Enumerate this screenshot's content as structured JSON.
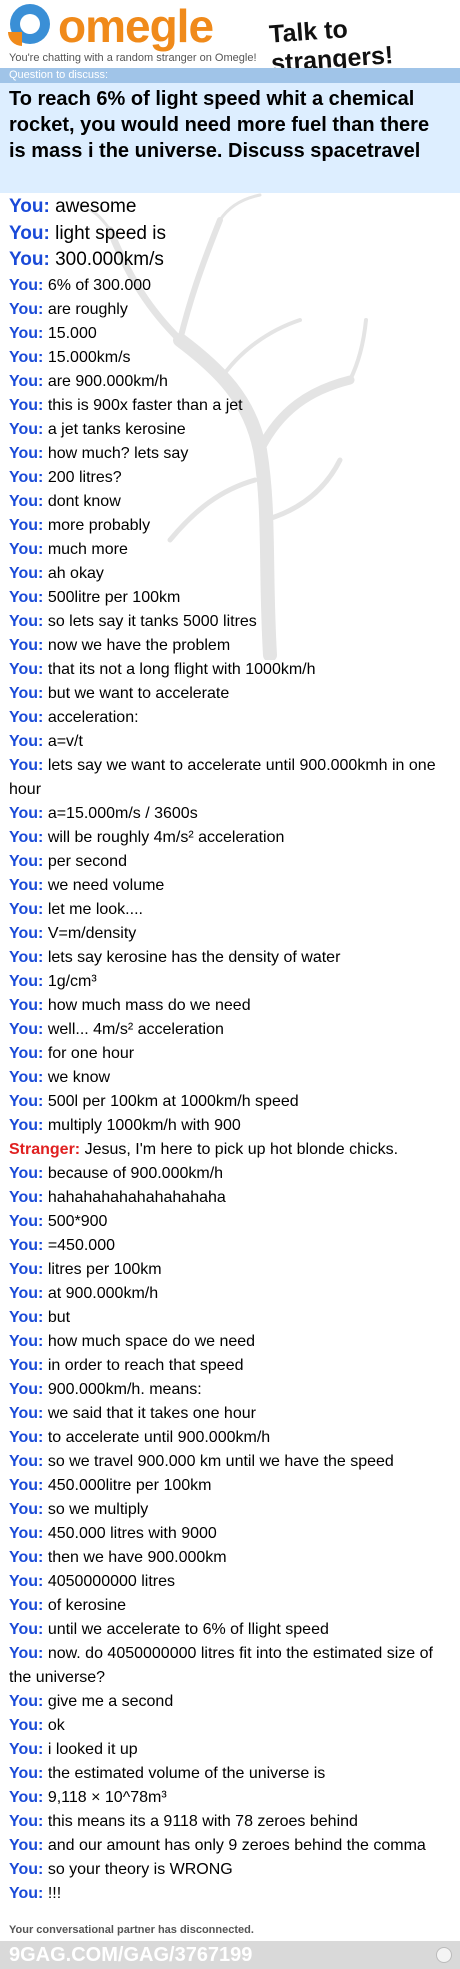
{
  "header": {
    "logo_text": "omegle",
    "tagline": "Talk to strangers!",
    "chatting_note": "You're chatting with a random stranger on Omegle!"
  },
  "question": {
    "label": "Question to discuss:",
    "text": "To reach 6% of light speed whit a chemical rocket, you would need more fuel than there is mass i the universe. Discuss spacetravel"
  },
  "messages": [
    {
      "speaker": "You:",
      "text": "awesome"
    },
    {
      "speaker": "You:",
      "text": "light speed is"
    },
    {
      "speaker": "You:",
      "text": "300.000km/s"
    },
    {
      "speaker": "You:",
      "text": "6% of 300.000"
    },
    {
      "speaker": "You:",
      "text": "are roughly"
    },
    {
      "speaker": "You:",
      "text": "15.000"
    },
    {
      "speaker": "You:",
      "text": "15.000km/s"
    },
    {
      "speaker": "You:",
      "text": "are 900.000km/h"
    },
    {
      "speaker": "You:",
      "text": "this is 900x faster than a jet"
    },
    {
      "speaker": "You:",
      "text": "a jet tanks kerosine"
    },
    {
      "speaker": "You:",
      "text": "how much? lets say"
    },
    {
      "speaker": "You:",
      "text": "200 litres?"
    },
    {
      "speaker": "You:",
      "text": "dont know"
    },
    {
      "speaker": "You:",
      "text": "more probably"
    },
    {
      "speaker": "You:",
      "text": "much more"
    },
    {
      "speaker": "You:",
      "text": "ah okay"
    },
    {
      "speaker": "You:",
      "text": "500litre per 100km"
    },
    {
      "speaker": "You:",
      "text": "so lets say it tanks 5000 litres"
    },
    {
      "speaker": "You:",
      "text": "now we have the problem"
    },
    {
      "speaker": "You:",
      "text": "that its not a long flight with 1000km/h"
    },
    {
      "speaker": "You:",
      "text": "but we want to accelerate"
    },
    {
      "speaker": "You:",
      "text": "acceleration:"
    },
    {
      "speaker": "You:",
      "text": "a=v/t"
    },
    {
      "speaker": "You:",
      "text": "lets say we want to accelerate until 900.000kmh in one hour"
    },
    {
      "speaker": "You:",
      "text": "a=15.000m/s   /   3600s"
    },
    {
      "speaker": "You:",
      "text": "will be roughly 4m/s²  acceleration"
    },
    {
      "speaker": "You:",
      "text": "per second"
    },
    {
      "speaker": "You:",
      "text": "we need volume"
    },
    {
      "speaker": "You:",
      "text": "let me look...."
    },
    {
      "speaker": "You:",
      "text": "V=m/density"
    },
    {
      "speaker": "You:",
      "text": "lets say kerosine has the density of water"
    },
    {
      "speaker": "You:",
      "text": "1g/cm³"
    },
    {
      "speaker": "You:",
      "text": "how much mass do we need"
    },
    {
      "speaker": "You:",
      "text": "well... 4m/s² acceleration"
    },
    {
      "speaker": "You:",
      "text": "for one hour"
    },
    {
      "speaker": "You:",
      "text": "we know"
    },
    {
      "speaker": "You:",
      "text": "500l per 100km at 1000km/h speed"
    },
    {
      "speaker": "You:",
      "text": "multiply 1000km/h with 900"
    },
    {
      "speaker": "Stranger:",
      "text": "Jesus, I'm here to pick up hot blonde chicks."
    },
    {
      "speaker": "You:",
      "text": "because of 900.000km/h"
    },
    {
      "speaker": "You:",
      "text": "hahahahahahahahahaha"
    },
    {
      "speaker": "You:",
      "text": "500*900"
    },
    {
      "speaker": "You:",
      "text": "=450.000"
    },
    {
      "speaker": "You:",
      "text": "litres per 100km"
    },
    {
      "speaker": "You:",
      "text": "at 900.000km/h"
    },
    {
      "speaker": "You:",
      "text": "but"
    },
    {
      "speaker": "You:",
      "text": "how much space do we need"
    },
    {
      "speaker": "You:",
      "text": "in order to reach that speed"
    },
    {
      "speaker": "You:",
      "text": "900.000km/h. means:"
    },
    {
      "speaker": "You:",
      "text": "we said that it takes one hour"
    },
    {
      "speaker": "You:",
      "text": "to accelerate until 900.000km/h"
    },
    {
      "speaker": "You:",
      "text": "so we travel 900.000 km until we have the speed"
    },
    {
      "speaker": "You:",
      "text": "450.000litre per 100km"
    },
    {
      "speaker": "You:",
      "text": "so we multiply"
    },
    {
      "speaker": "You:",
      "text": "450.000 litres with 9000"
    },
    {
      "speaker": "You:",
      "text": "then we have 900.000km"
    },
    {
      "speaker": "You:",
      "text": "4050000000 litres"
    },
    {
      "speaker": "You:",
      "text": "of kerosine"
    },
    {
      "speaker": "You:",
      "text": "until we accelerate to 6% of llight speed"
    },
    {
      "speaker": "You:",
      "text": "now. do 4050000000 litres fit into the estimated size of the universe?"
    },
    {
      "speaker": "You:",
      "text": "give me a second"
    },
    {
      "speaker": "You:",
      "text": "ok"
    },
    {
      "speaker": "You:",
      "text": "i looked it up"
    },
    {
      "speaker": "You:",
      "text": "the estimated volume of the universe is"
    },
    {
      "speaker": "You:",
      "text": "9,118 × 10^78m³"
    },
    {
      "speaker": "You:",
      "text": "this means its a 9118 with 78 zeroes behind"
    },
    {
      "speaker": "You:",
      "text": "and our amount has only 9 zeroes behind the comma"
    },
    {
      "speaker": "You:",
      "text": "so your theory is WRONG"
    },
    {
      "speaker": "You:",
      "text": "!!!"
    }
  ],
  "disconnected_note": "Your conversational partner has disconnected.",
  "footer": {
    "watermark": "9GAG.COM/GAG/3767199"
  },
  "colors": {
    "you": "#1a4ad8",
    "stranger": "#e02020",
    "question_bg": "#ddeeff",
    "question_label_bg": "#a0c4e8",
    "logo_orange": "#f08a1a",
    "logo_blue": "#3a8fd6"
  }
}
